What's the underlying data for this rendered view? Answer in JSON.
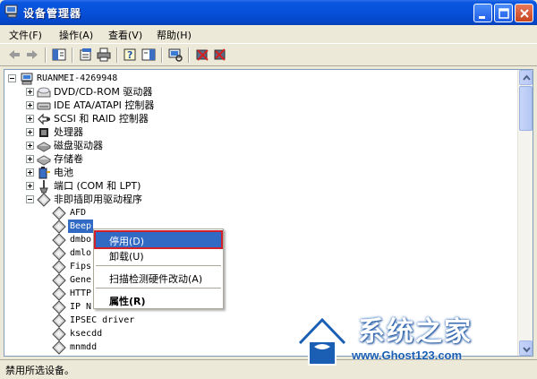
{
  "window": {
    "title": "设备管理器"
  },
  "menubar": {
    "items": [
      "文件(F)",
      "操作(A)",
      "查看(V)",
      "帮助(H)"
    ]
  },
  "tree": {
    "root": "RUANMEI-4269948",
    "categories": [
      "DVD/CD-ROM 驱动器",
      "IDE ATA/ATAPI 控制器",
      "SCSI 和 RAID 控制器",
      "处理器",
      "磁盘驱动器",
      "存储卷",
      "电池",
      "端口 (COM 和 LPT)",
      "非即插即用驱动程序"
    ],
    "drivers": [
      "AFD",
      "Beep",
      "dmbo",
      "dmlo",
      "Fips",
      "Gene",
      "HTTP",
      "IP N",
      "IPSEC driver",
      "ksecdd",
      "mnmdd"
    ]
  },
  "context_menu": {
    "items": [
      "停用(D)",
      "卸载(U)",
      "扫描检测硬件改动(A)",
      "属性(R)"
    ],
    "highlighted": "停用(D)"
  },
  "statusbar": {
    "text": "禁用所选设备。"
  },
  "watermark": {
    "cn": "系统之家",
    "url": "www.Ghost123.com"
  },
  "colors": {
    "titlebar": "#0650D8",
    "selection": "#316AC5",
    "highlight_border": "#D0202A"
  }
}
